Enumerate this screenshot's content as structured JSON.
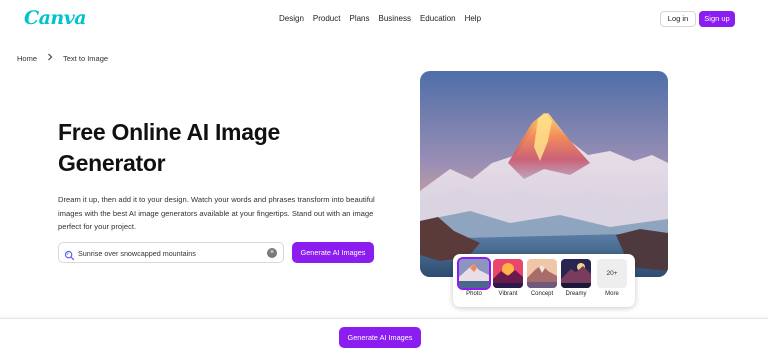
{
  "header": {
    "logo": "Canva",
    "nav": [
      "Design",
      "Product",
      "Plans",
      "Business",
      "Education",
      "Help"
    ],
    "login_label": "Log in",
    "signup_label": "Sign up"
  },
  "breadcrumb": {
    "home": "Home",
    "current": "Text to Image"
  },
  "hero": {
    "title": "Free Online AI Image Generator",
    "description": "Dream it up, then add it to your design. Watch your words and phrases transform into beautiful images with the best AI image generators available at your fingertips. Stand out with an image perfect for your project.",
    "search_value": "Sunrise over snowcapped mountains",
    "generate_label": "Generate AI Images"
  },
  "styles": {
    "items": [
      "Photo",
      "Vibrant",
      "Concept",
      "Dreamy"
    ],
    "more_count": "20+",
    "more_label": "More",
    "selected": "Photo"
  },
  "bottom_bar": {
    "generate_label": "Generate AI Images"
  },
  "colors": {
    "brand_purple": "#8b1df0",
    "logo_teal": "#00c4cc"
  },
  "icons": {
    "search": "sparkle-search-icon",
    "clear": "clear-icon",
    "breadcrumb_separator": "chevron-right-icon"
  }
}
